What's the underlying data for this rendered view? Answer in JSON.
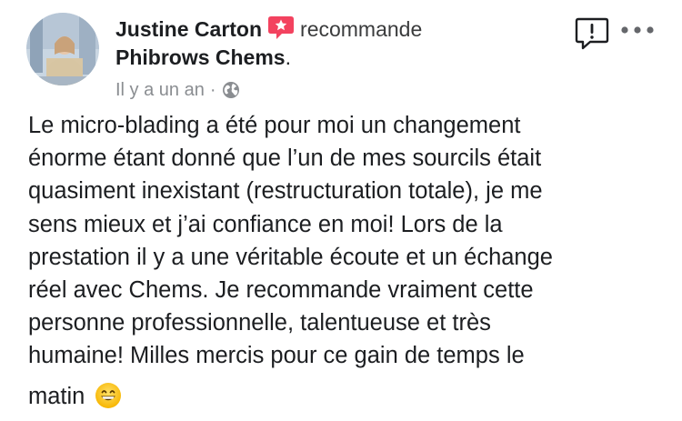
{
  "post": {
    "author": "Justine Carton",
    "action": "recommande",
    "page": "Phibrows Chems",
    "page_suffix": ".",
    "time": "Il y a un an",
    "separator": "·",
    "privacy_icon": "globe-icon",
    "badge_icon": "recommendation-badge-icon",
    "report_icon": "report-exclamation-icon",
    "more_icon": "more-dots-icon",
    "review_lines": [
      "Le micro-blading a été pour moi un changement",
      "énorme étant donné que l’un de mes sourcils était",
      "quasiment inexistant (restructuration totale), je me",
      "sens mieux et j’ai confiance en moi! Lors de la",
      "prestation il y a une véritable écoute et un échange",
      "réel avec Chems. Je recommande vraiment cette",
      "personne professionnelle, talentueuse et très",
      "humaine! Milles mercis pour ce gain de temps le",
      "matin"
    ],
    "emoji": "grinning-face-emoji"
  },
  "colors": {
    "badge": "#f3425f",
    "secondary_text": "#8a8d91",
    "primary_text": "#1c1e21"
  }
}
